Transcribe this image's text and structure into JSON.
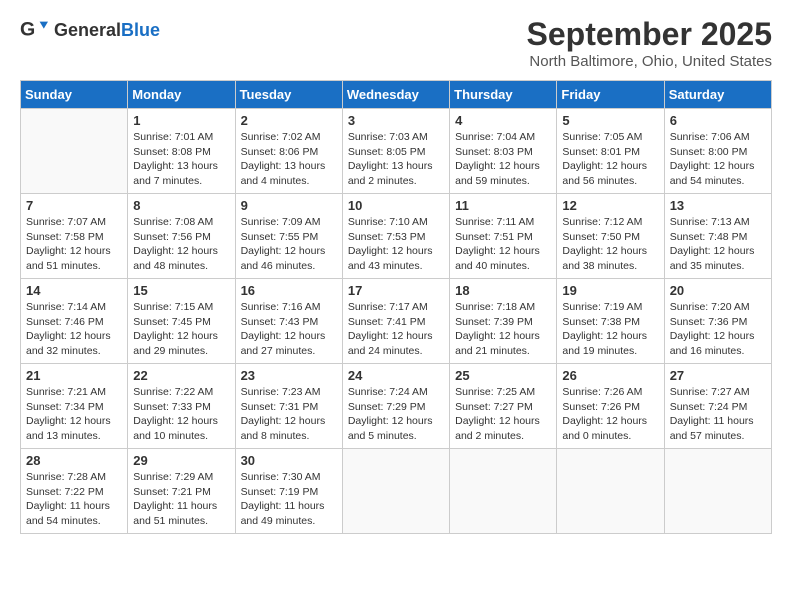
{
  "logo": {
    "general": "General",
    "blue": "Blue"
  },
  "header": {
    "month": "September 2025",
    "location": "North Baltimore, Ohio, United States"
  },
  "days": [
    "Sunday",
    "Monday",
    "Tuesday",
    "Wednesday",
    "Thursday",
    "Friday",
    "Saturday"
  ],
  "weeks": [
    [
      {
        "day": "",
        "content": ""
      },
      {
        "day": "1",
        "content": "Sunrise: 7:01 AM\nSunset: 8:08 PM\nDaylight: 13 hours\nand 7 minutes."
      },
      {
        "day": "2",
        "content": "Sunrise: 7:02 AM\nSunset: 8:06 PM\nDaylight: 13 hours\nand 4 minutes."
      },
      {
        "day": "3",
        "content": "Sunrise: 7:03 AM\nSunset: 8:05 PM\nDaylight: 13 hours\nand 2 minutes."
      },
      {
        "day": "4",
        "content": "Sunrise: 7:04 AM\nSunset: 8:03 PM\nDaylight: 12 hours\nand 59 minutes."
      },
      {
        "day": "5",
        "content": "Sunrise: 7:05 AM\nSunset: 8:01 PM\nDaylight: 12 hours\nand 56 minutes."
      },
      {
        "day": "6",
        "content": "Sunrise: 7:06 AM\nSunset: 8:00 PM\nDaylight: 12 hours\nand 54 minutes."
      }
    ],
    [
      {
        "day": "7",
        "content": "Sunrise: 7:07 AM\nSunset: 7:58 PM\nDaylight: 12 hours\nand 51 minutes."
      },
      {
        "day": "8",
        "content": "Sunrise: 7:08 AM\nSunset: 7:56 PM\nDaylight: 12 hours\nand 48 minutes."
      },
      {
        "day": "9",
        "content": "Sunrise: 7:09 AM\nSunset: 7:55 PM\nDaylight: 12 hours\nand 46 minutes."
      },
      {
        "day": "10",
        "content": "Sunrise: 7:10 AM\nSunset: 7:53 PM\nDaylight: 12 hours\nand 43 minutes."
      },
      {
        "day": "11",
        "content": "Sunrise: 7:11 AM\nSunset: 7:51 PM\nDaylight: 12 hours\nand 40 minutes."
      },
      {
        "day": "12",
        "content": "Sunrise: 7:12 AM\nSunset: 7:50 PM\nDaylight: 12 hours\nand 38 minutes."
      },
      {
        "day": "13",
        "content": "Sunrise: 7:13 AM\nSunset: 7:48 PM\nDaylight: 12 hours\nand 35 minutes."
      }
    ],
    [
      {
        "day": "14",
        "content": "Sunrise: 7:14 AM\nSunset: 7:46 PM\nDaylight: 12 hours\nand 32 minutes."
      },
      {
        "day": "15",
        "content": "Sunrise: 7:15 AM\nSunset: 7:45 PM\nDaylight: 12 hours\nand 29 minutes."
      },
      {
        "day": "16",
        "content": "Sunrise: 7:16 AM\nSunset: 7:43 PM\nDaylight: 12 hours\nand 27 minutes."
      },
      {
        "day": "17",
        "content": "Sunrise: 7:17 AM\nSunset: 7:41 PM\nDaylight: 12 hours\nand 24 minutes."
      },
      {
        "day": "18",
        "content": "Sunrise: 7:18 AM\nSunset: 7:39 PM\nDaylight: 12 hours\nand 21 minutes."
      },
      {
        "day": "19",
        "content": "Sunrise: 7:19 AM\nSunset: 7:38 PM\nDaylight: 12 hours\nand 19 minutes."
      },
      {
        "day": "20",
        "content": "Sunrise: 7:20 AM\nSunset: 7:36 PM\nDaylight: 12 hours\nand 16 minutes."
      }
    ],
    [
      {
        "day": "21",
        "content": "Sunrise: 7:21 AM\nSunset: 7:34 PM\nDaylight: 12 hours\nand 13 minutes."
      },
      {
        "day": "22",
        "content": "Sunrise: 7:22 AM\nSunset: 7:33 PM\nDaylight: 12 hours\nand 10 minutes."
      },
      {
        "day": "23",
        "content": "Sunrise: 7:23 AM\nSunset: 7:31 PM\nDaylight: 12 hours\nand 8 minutes."
      },
      {
        "day": "24",
        "content": "Sunrise: 7:24 AM\nSunset: 7:29 PM\nDaylight: 12 hours\nand 5 minutes."
      },
      {
        "day": "25",
        "content": "Sunrise: 7:25 AM\nSunset: 7:27 PM\nDaylight: 12 hours\nand 2 minutes."
      },
      {
        "day": "26",
        "content": "Sunrise: 7:26 AM\nSunset: 7:26 PM\nDaylight: 12 hours\nand 0 minutes."
      },
      {
        "day": "27",
        "content": "Sunrise: 7:27 AM\nSunset: 7:24 PM\nDaylight: 11 hours\nand 57 minutes."
      }
    ],
    [
      {
        "day": "28",
        "content": "Sunrise: 7:28 AM\nSunset: 7:22 PM\nDaylight: 11 hours\nand 54 minutes."
      },
      {
        "day": "29",
        "content": "Sunrise: 7:29 AM\nSunset: 7:21 PM\nDaylight: 11 hours\nand 51 minutes."
      },
      {
        "day": "30",
        "content": "Sunrise: 7:30 AM\nSunset: 7:19 PM\nDaylight: 11 hours\nand 49 minutes."
      },
      {
        "day": "",
        "content": ""
      },
      {
        "day": "",
        "content": ""
      },
      {
        "day": "",
        "content": ""
      },
      {
        "day": "",
        "content": ""
      }
    ]
  ]
}
